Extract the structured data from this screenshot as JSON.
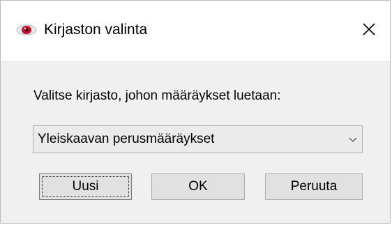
{
  "window": {
    "title": "Kirjaston valinta",
    "icon": "eye-icon",
    "close_icon": "close-icon"
  },
  "form": {
    "prompt": "Valitse kirjasto, johon määräykset luetaan:",
    "library_select": {
      "selected": "Yleiskaavan perusmääräykset",
      "arrow_icon": "chevron-down-icon"
    }
  },
  "buttons": {
    "new_label": "Uusi",
    "ok_label": "OK",
    "cancel_label": "Peruuta"
  },
  "colors": {
    "icon_red": "#c8102e",
    "dialog_bg": "#f0f0f0",
    "button_bg": "#e1e1e1",
    "border": "#adadad"
  }
}
